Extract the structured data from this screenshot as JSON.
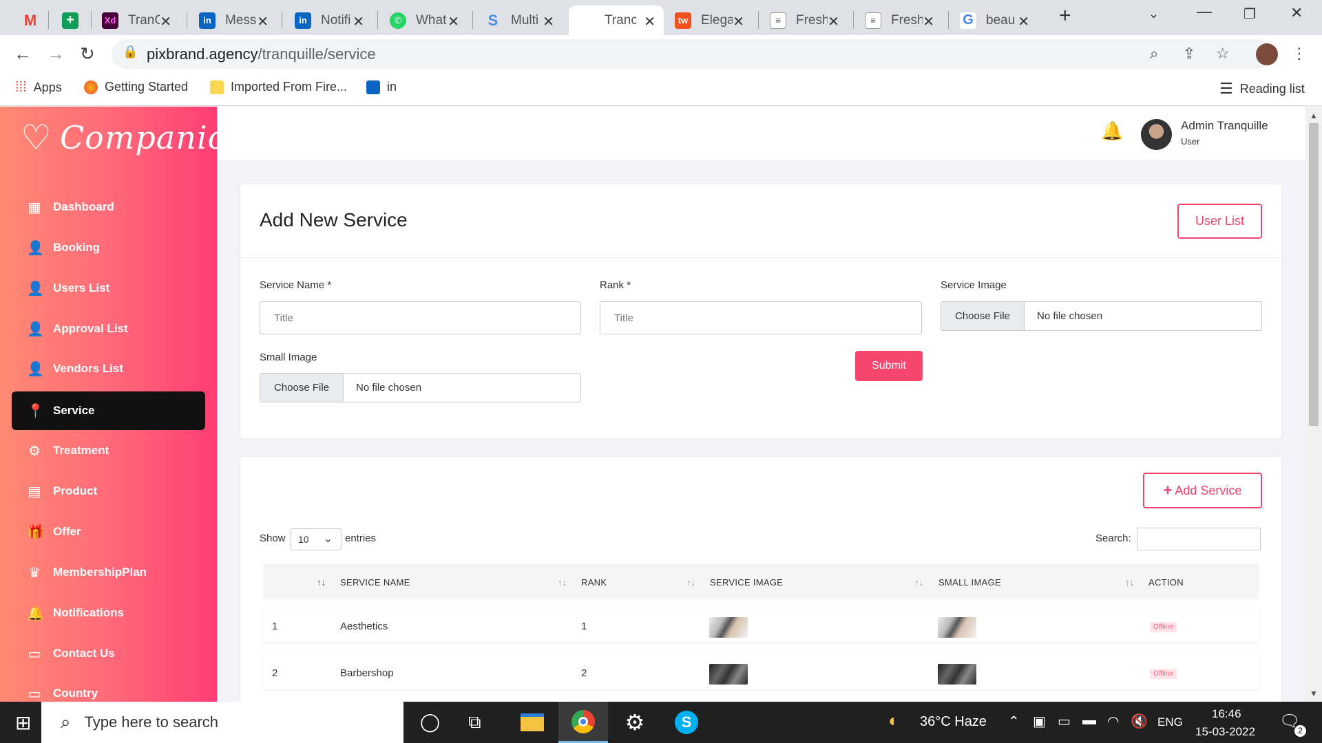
{
  "browser": {
    "tabs": [
      {
        "title": "",
        "icon": "gmail-icon",
        "color": "#ea4335"
      },
      {
        "title": "",
        "icon": "sheets-plus-icon",
        "color": "#0f9d58"
      },
      {
        "title": "TranC",
        "icon": "xd-icon",
        "color": "#470137"
      },
      {
        "title": "Mess",
        "icon": "linkedin-icon",
        "color": "#0a66c2"
      },
      {
        "title": "Notifi",
        "icon": "linkedin-icon",
        "color": "#0a66c2"
      },
      {
        "title": "What",
        "icon": "whatsapp-icon",
        "color": "#25d366"
      },
      {
        "title": "Multi",
        "icon": "s-icon",
        "color": "#4a90e2"
      },
      {
        "title": "Tranc",
        "icon": "blank-icon",
        "color": "#ffffff"
      },
      {
        "title": "Elega",
        "icon": "tw-icon",
        "color": "#f4511e"
      },
      {
        "title": "Fresh",
        "icon": "doc-icon",
        "color": "#ffffff"
      },
      {
        "title": "Fresh",
        "icon": "doc-icon",
        "color": "#ffffff"
      },
      {
        "title": "beau",
        "icon": "google-icon",
        "color": "#ffffff"
      }
    ],
    "url_domain": "pixbrand.agency",
    "url_path": "/tranquille/service",
    "bookmarks": [
      "Apps",
      "Getting Started",
      "Imported From Fire...",
      "in"
    ],
    "reading_list": "Reading list"
  },
  "app": {
    "logo_text": "Companion",
    "accent_color": "#f6466e",
    "nav": [
      {
        "label": "Dashboard",
        "icon": "dashboard-icon"
      },
      {
        "label": "Booking",
        "icon": "user-icon"
      },
      {
        "label": "Users List",
        "icon": "user-icon"
      },
      {
        "label": "Approval List",
        "icon": "user-icon"
      },
      {
        "label": "Vendors List",
        "icon": "user-icon"
      },
      {
        "label": "Service",
        "icon": "map-pin-icon",
        "active": true
      },
      {
        "label": "Treatment",
        "icon": "gear-icon"
      },
      {
        "label": "Product",
        "icon": "calendar-icon"
      },
      {
        "label": "Offer",
        "icon": "gift-icon"
      },
      {
        "label": "MembershipPlan",
        "icon": "membership-icon"
      },
      {
        "label": "Notifications",
        "icon": "bell-icon"
      },
      {
        "label": "Contact Us",
        "icon": "contact-icon"
      },
      {
        "label": "Country",
        "icon": "contact-icon"
      }
    ],
    "user": {
      "name": "Admin Tranquille",
      "role": "User"
    }
  },
  "form": {
    "title": "Add New Service",
    "user_list_button": "User List",
    "service_name_label": "Service Name *",
    "service_name_placeholder": "Title",
    "rank_label": "Rank *",
    "rank_placeholder": "Title",
    "service_image_label": "Service Image",
    "small_image_label": "Small Image",
    "choose_file": "Choose File",
    "no_file": "No file chosen",
    "submit": "Submit"
  },
  "table": {
    "add_button": "Add Service",
    "show_label": "Show",
    "page_size": "10",
    "entries_label": "entries",
    "search_label": "Search:",
    "columns": [
      "",
      "SERVICE NAME",
      "RANK",
      "SERVICE IMAGE",
      "SMALL IMAGE",
      "ACTION"
    ],
    "rows": [
      {
        "index": "1",
        "name": "Aesthetics",
        "rank": "1",
        "status": "Offline"
      },
      {
        "index": "2",
        "name": "Barbershop",
        "rank": "2",
        "status": "Offline"
      }
    ]
  },
  "taskbar": {
    "search_placeholder": "Type here to search",
    "weather": "36°C  Haze",
    "language": "ENG",
    "time": "16:46",
    "date": "15-03-2022",
    "notification_count": "2"
  }
}
